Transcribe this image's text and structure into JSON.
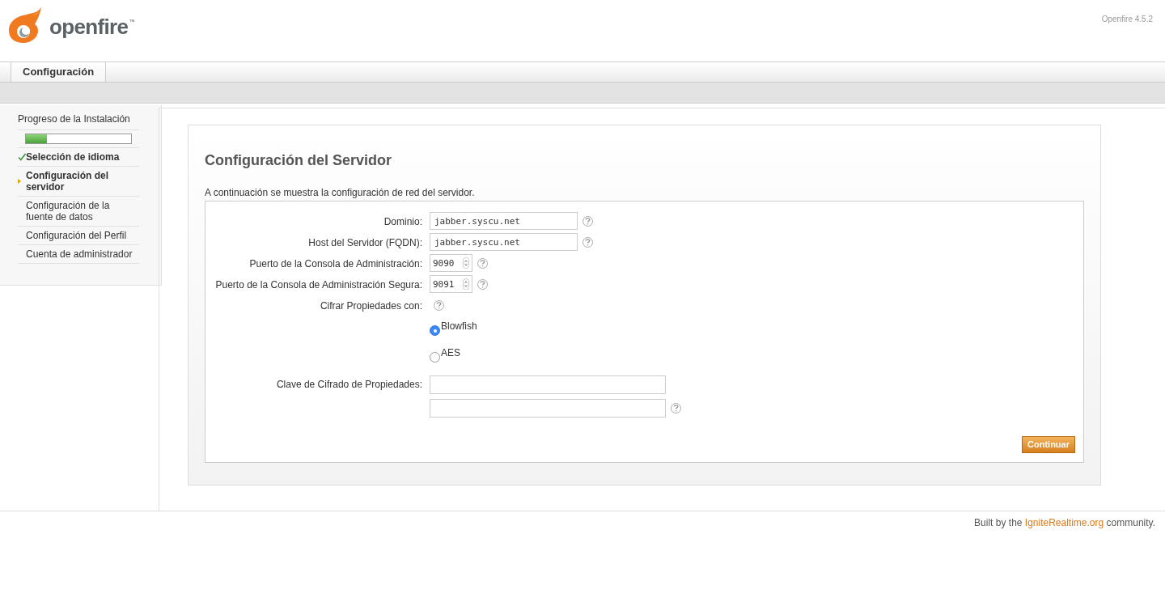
{
  "header": {
    "logo_text": "openfire",
    "logo_mark": "™",
    "version": "Openfire 4.5.2"
  },
  "tabs": [
    {
      "label": "Configuración",
      "selected": true
    }
  ],
  "sidebar": {
    "title": "Progreso de la Instalación",
    "progress": {
      "level": 0.2
    },
    "steps": [
      {
        "label": "Selección de idioma",
        "completed": true,
        "current": false
      },
      {
        "label": "Configuración del servidor",
        "completed": false,
        "current": true
      },
      {
        "label": "Configuración de la fuente de datos",
        "completed": false,
        "current": false
      },
      {
        "label": "Configuración del Perfil",
        "completed": false,
        "current": false
      },
      {
        "label": "Cuenta de administrador",
        "completed": false,
        "current": false
      }
    ]
  },
  "page": {
    "title": "Configuración del Servidor",
    "description": "A continuación se muestra la configuración de red del servidor.",
    "fields": [
      {
        "kind": "text",
        "label": "Dominio:",
        "value": "jabber.syscu.net",
        "help": true
      },
      {
        "kind": "text",
        "label": "Host del Servidor (FQDN):",
        "value": "jabber.syscu.net",
        "help": true
      },
      {
        "kind": "number",
        "label": "Puerto de la Consola de Administración:",
        "value": "9090",
        "help": true
      },
      {
        "kind": "number",
        "label": "Puerto de la Consola de Administración Segura:",
        "value": "9091",
        "help": true
      },
      {
        "kind": "radio",
        "label": "Cifrar Propiedades con:",
        "help": true,
        "options": [
          {
            "label": "Blowfish",
            "selected": true
          },
          {
            "label": "AES",
            "selected": false
          }
        ]
      },
      {
        "kind": "key",
        "label": "Clave de Cifrado de Propiedades:",
        "help": true
      }
    ],
    "button": "Continuar"
  },
  "footer": {
    "before": "Built by the",
    "link": "IgniteRealtime.org",
    "after": "community."
  }
}
